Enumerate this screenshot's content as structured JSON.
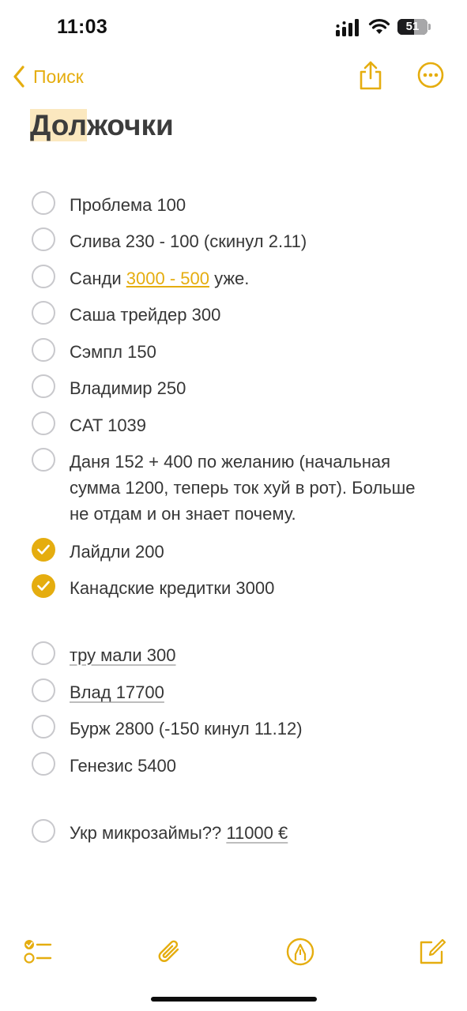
{
  "status_bar": {
    "time": "11:03",
    "battery": "51"
  },
  "nav": {
    "back_label": "Поиск"
  },
  "note": {
    "title_highlight": "Дол",
    "title_rest": "жочки",
    "items": [
      {
        "text": "Проблема 100",
        "checked": false
      },
      {
        "text": "Слива 230 - 100 (скинул 2.11)",
        "checked": false
      },
      {
        "prefix": "Санди ",
        "link": "3000 - 500",
        "suffix": " уже.",
        "checked": false
      },
      {
        "text": "Саша трейдер 300",
        "checked": false
      },
      {
        "text": "Сэмпл 150",
        "checked": false
      },
      {
        "text": "Владимир 250",
        "checked": false
      },
      {
        "text": "CAT 1039",
        "checked": false
      },
      {
        "text": "Даня 152 + 400 по желанию (начальная сумма 1200, теперь ток хуй в рот). Больше не отдам и он знает почему.",
        "checked": false
      },
      {
        "text": "Лайдли 200",
        "checked": true
      },
      {
        "text": "Канадские кредитки 3000",
        "checked": true
      },
      {
        "text": "тру мали 300",
        "checked": false
      },
      {
        "text": "Влад 17700",
        "checked": false
      },
      {
        "text": "Бурж 2800 (-150 кинул 11.12)",
        "checked": false
      },
      {
        "text": "Генезис 5400",
        "checked": false
      },
      {
        "prefix": "Укр микрозаймы?? ",
        "amount": "11000 €",
        "checked": false
      }
    ]
  },
  "colors": {
    "accent": "#e5ad0f",
    "title_highlight": "#fbe8bf"
  },
  "toolbar": {
    "icons": [
      "checklist-icon",
      "paperclip-icon",
      "markup-pen-icon",
      "compose-icon"
    ]
  }
}
